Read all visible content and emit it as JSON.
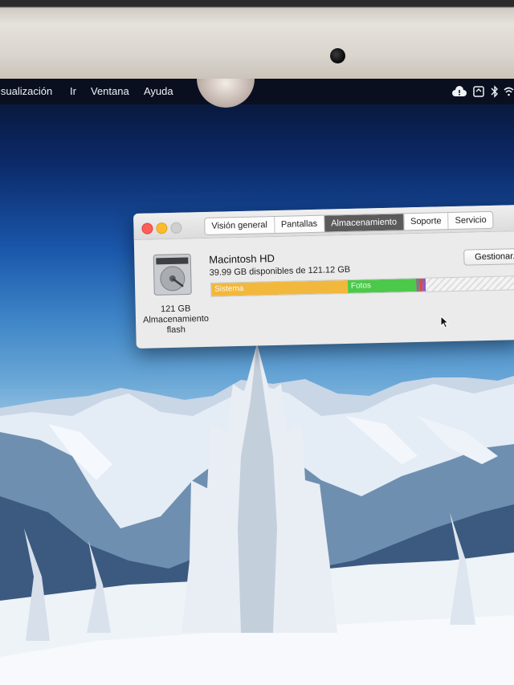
{
  "menubar": {
    "items": [
      "isualización",
      "Ir",
      "Ventana",
      "Ayuda"
    ]
  },
  "status_icons": [
    "cloud-alert-icon",
    "time-machine-icon",
    "bluetooth-icon",
    "wifi-icon"
  ],
  "window": {
    "tabs": [
      {
        "label": "Visión general",
        "active": false
      },
      {
        "label": "Pantallas",
        "active": false
      },
      {
        "label": "Almacenamiento",
        "active": true
      },
      {
        "label": "Soporte",
        "active": false
      },
      {
        "label": "Servicio",
        "active": false
      }
    ],
    "disk": {
      "capacity": "121 GB",
      "type_line1": "Almacenamiento",
      "type_line2": "flash"
    },
    "volume": {
      "name": "Macintosh HD",
      "available": "39.99 GB disponibles de 121.12 GB",
      "manage_label": "Gestionar..."
    },
    "storage_bar": {
      "segments": [
        {
          "label": "Sistema",
          "fraction": 0.44,
          "color": "#f2b83c"
        },
        {
          "label": "Fotos",
          "fraction": 0.22,
          "color": "#4cc94a"
        },
        {
          "label": "",
          "fraction": 0.01,
          "color": "#7d7d7d"
        },
        {
          "label": "",
          "fraction": 0.006,
          "color": "#d64b3f"
        },
        {
          "label": "",
          "fraction": 0.006,
          "color": "#8b5cc8"
        }
      ],
      "free_fraction": 0.318
    }
  }
}
